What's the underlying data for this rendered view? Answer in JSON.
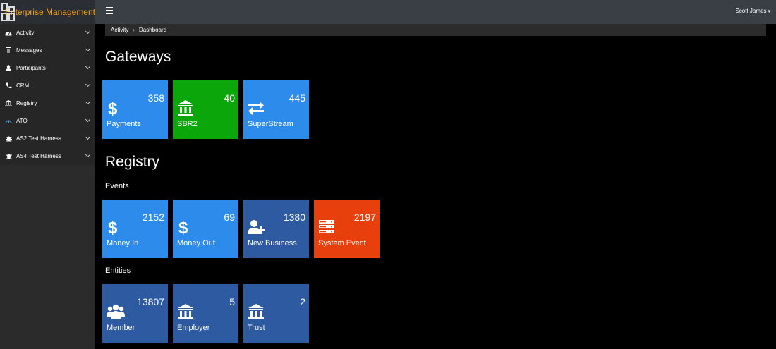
{
  "app": {
    "title": "Enterprise Management",
    "user": "Scott James"
  },
  "colors": {
    "blue": "#2d8ceb",
    "green": "#0aa60a",
    "navy": "#2e5aa1",
    "red": "#e8400c"
  },
  "sidebar": {
    "items": [
      {
        "label": "Activity",
        "icon": "dashboard-icon"
      },
      {
        "label": "Messages",
        "icon": "document-icon"
      },
      {
        "label": "Participants",
        "icon": "person-icon"
      },
      {
        "label": "CRM",
        "icon": "phone-icon"
      },
      {
        "label": "Registry",
        "icon": "bank-icon"
      },
      {
        "label": "ATO",
        "icon": "ato-icon"
      },
      {
        "label": "AS2 Test Harness",
        "icon": "bug-icon"
      },
      {
        "label": "AS4 Test Harness",
        "icon": "bug-icon"
      }
    ]
  },
  "breadcrumb": {
    "parent": "Activity",
    "current": "Dashboard"
  },
  "gateways": {
    "heading": "Gateways",
    "tiles": [
      {
        "label": "Payments",
        "count": "358",
        "icon": "dollar-icon"
      },
      {
        "label": "SBR2",
        "count": "40",
        "icon": "bank-icon"
      },
      {
        "label": "SuperStream",
        "count": "445",
        "icon": "exchange-icon"
      }
    ]
  },
  "registry": {
    "heading": "Registry",
    "events": {
      "heading": "Events",
      "tiles": [
        {
          "label": "Money In",
          "count": "2152",
          "icon": "dollar-icon"
        },
        {
          "label": "Money Out",
          "count": "69",
          "icon": "dollar-icon"
        },
        {
          "label": "New Business",
          "count": "1380",
          "icon": "user-plus-icon"
        },
        {
          "label": "System Event",
          "count": "2197",
          "icon": "server-icon"
        }
      ]
    },
    "entities": {
      "heading": "Entities",
      "tiles": [
        {
          "label": "Member",
          "count": "13807",
          "icon": "users-icon"
        },
        {
          "label": "Employer",
          "count": "5",
          "icon": "bank-icon"
        },
        {
          "label": "Trust",
          "count": "2",
          "icon": "bank-icon"
        }
      ]
    }
  }
}
